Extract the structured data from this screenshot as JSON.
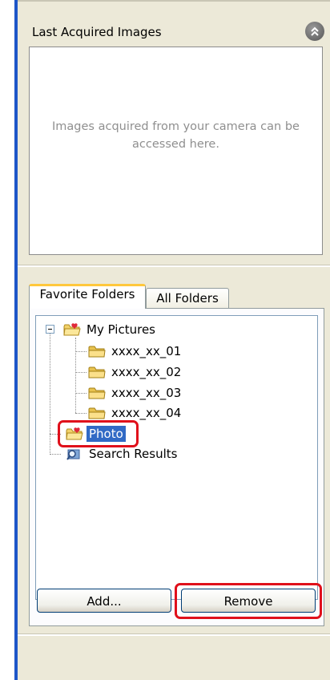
{
  "last_acquired": {
    "title": "Last Acquired Images",
    "message": "Images acquired from your camera can be accessed here."
  },
  "tabs": [
    {
      "label": "Favorite Folders",
      "active": true
    },
    {
      "label": "All Folders",
      "active": false
    }
  ],
  "tree": {
    "root": "My Pictures",
    "children": [
      "xxxx_xx_01",
      "xxxx_xx_02",
      "xxxx_xx_03",
      "xxxx_xx_04"
    ],
    "photo": "Photo",
    "search": "Search Results"
  },
  "buttons": {
    "add": "Add...",
    "remove": "Remove"
  },
  "colors": {
    "panel_bg": "#ece9d8",
    "selection": "#316ac5",
    "highlight": "#e0101b",
    "window_edge": "#1e56c8"
  },
  "icons": {
    "collapse": "double-chevron-up-icon",
    "folder": "folder-icon",
    "favorite_folder": "heart-folder-icon",
    "search": "search-results-icon"
  }
}
